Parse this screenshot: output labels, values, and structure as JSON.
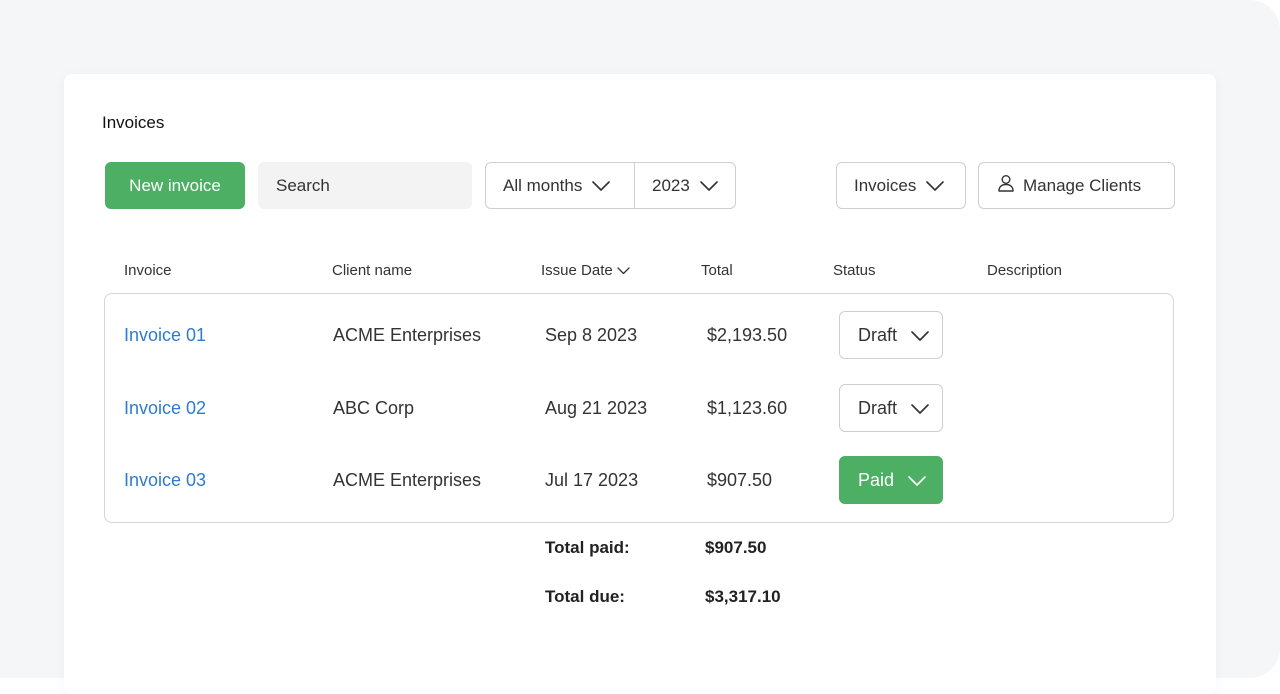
{
  "page": {
    "title": "Invoices"
  },
  "toolbar": {
    "new_invoice_label": "New invoice",
    "search_placeholder": "Search",
    "month_filter": "All months",
    "year_filter": "2023",
    "view_select": "Invoices",
    "manage_clients_label": "Manage Clients"
  },
  "table": {
    "columns": [
      "Invoice",
      "Client name",
      "Issue Date",
      "Total",
      "Status",
      "Description"
    ],
    "rows": [
      {
        "invoice": "Invoice 01",
        "client": "ACME Enterprises",
        "date": "Sep 8 2023",
        "total": "$2,193.50",
        "status": "Draft",
        "description": ""
      },
      {
        "invoice": "Invoice 02",
        "client": "ABC Corp",
        "date": "Aug 21 2023",
        "total": "$1,123.60",
        "status": "Draft",
        "description": ""
      },
      {
        "invoice": "Invoice 03",
        "client": "ACME Enterprises",
        "date": "Jul 17 2023",
        "total": "$907.50",
        "status": "Paid",
        "description": ""
      }
    ]
  },
  "totals": {
    "paid_label": "Total paid:",
    "paid_value": "$907.50",
    "due_label": "Total due:",
    "due_value": "$3,317.10"
  },
  "colors": {
    "accent_green": "#4caf64",
    "link_blue": "#2d7bd2",
    "background": "#f5f6f8"
  },
  "icons": [
    "chevron-down-icon",
    "user-icon"
  ]
}
